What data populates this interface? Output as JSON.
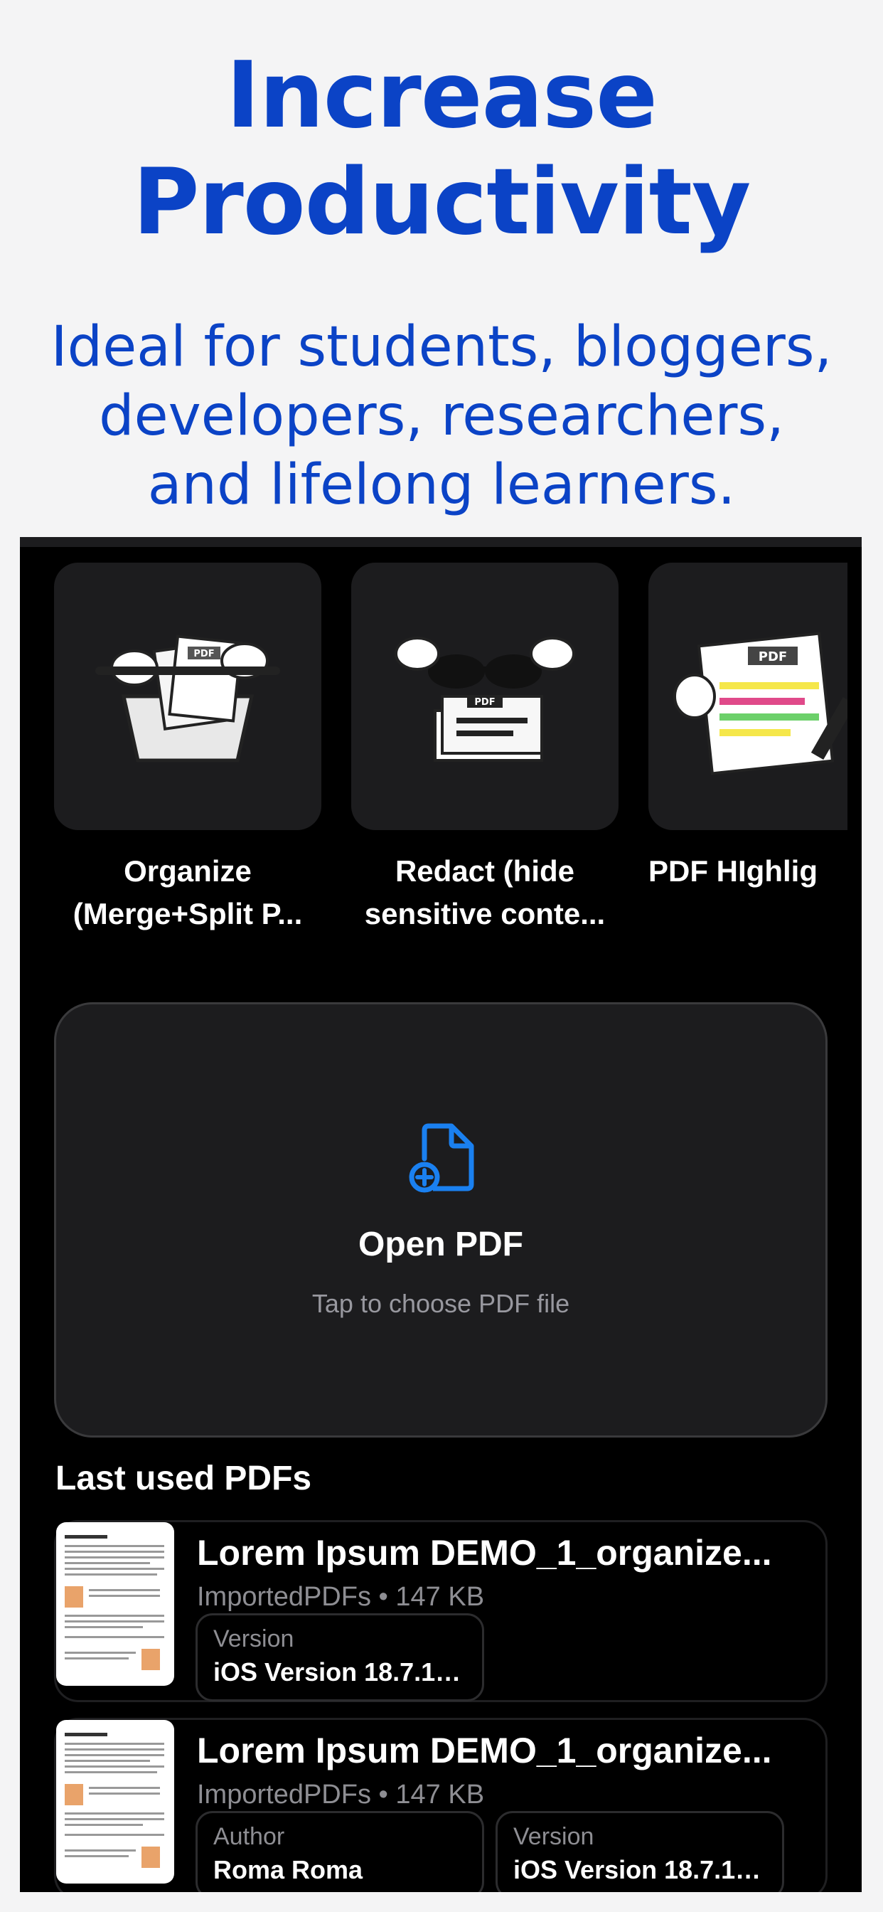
{
  "hero": {
    "headline": "Increase Productivity",
    "subline": "Ideal for students, bloggers, developers, researchers, and lifelong learners."
  },
  "tools": [
    {
      "label": "Organize\n(Merge+Split P...",
      "icon": "pdf-folder-icon"
    },
    {
      "label": "Redact (hide\nsensitive conte...",
      "icon": "pdf-sunglasses-icon"
    },
    {
      "label": "PDF HIghlig",
      "icon": "pdf-highlighter-icon"
    }
  ],
  "open_pdf": {
    "title": "Open PDF",
    "subtitle": "Tap to choose PDF file",
    "icon": "file-add-icon",
    "accent": "#1a80f0"
  },
  "recent": {
    "title": "Last used PDFs",
    "items": [
      {
        "name": "Lorem Ipsum DEMO_1_organize...",
        "folder": "ImportedPDFs",
        "size": "147 KB",
        "chips": [
          {
            "label": "Version",
            "value": "iOS Version 18.7.1 (..."
          }
        ]
      },
      {
        "name": "Lorem Ipsum DEMO_1_organize...",
        "folder": "ImportedPDFs",
        "size": "147 KB",
        "chips": [
          {
            "label": "Author",
            "value": "Roma Roma"
          },
          {
            "label": "Version",
            "value": "iOS Version 18.7.1 (..."
          }
        ]
      }
    ]
  },
  "colors": {
    "headline": "#0b43c6",
    "background": "#f4f4f5",
    "app_bg": "#000000",
    "card": "#1c1c1e"
  }
}
